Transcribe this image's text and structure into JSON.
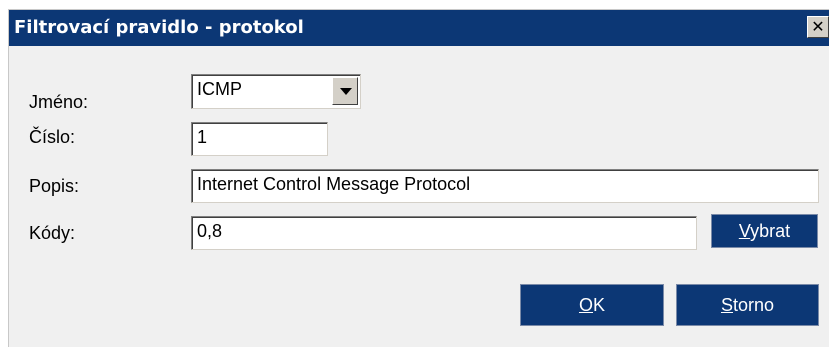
{
  "dialog": {
    "title": "Filtrovací pravidlo - protokol",
    "close_glyph": "✕"
  },
  "form": {
    "name_label": "Jméno:",
    "name_value": "ICMP",
    "number_label": "Číslo:",
    "number_value": "1",
    "description_label": "Popis:",
    "description_value": "Internet Control Message Protocol",
    "codes_label": "Kódy:",
    "codes_value": "0,8"
  },
  "buttons": {
    "select_mnemonic": "V",
    "select_rest": "ybrat",
    "ok_mnemonic": "O",
    "ok_rest": "K",
    "cancel_mnemonic": "S",
    "cancel_rest": "torno"
  },
  "icons": {
    "close": "close-icon",
    "dropdown": "chevron-down-icon"
  },
  "colors": {
    "titlebar": "#0c3775",
    "button": "#0c3775",
    "dialog_bg": "#f0f0f0"
  }
}
